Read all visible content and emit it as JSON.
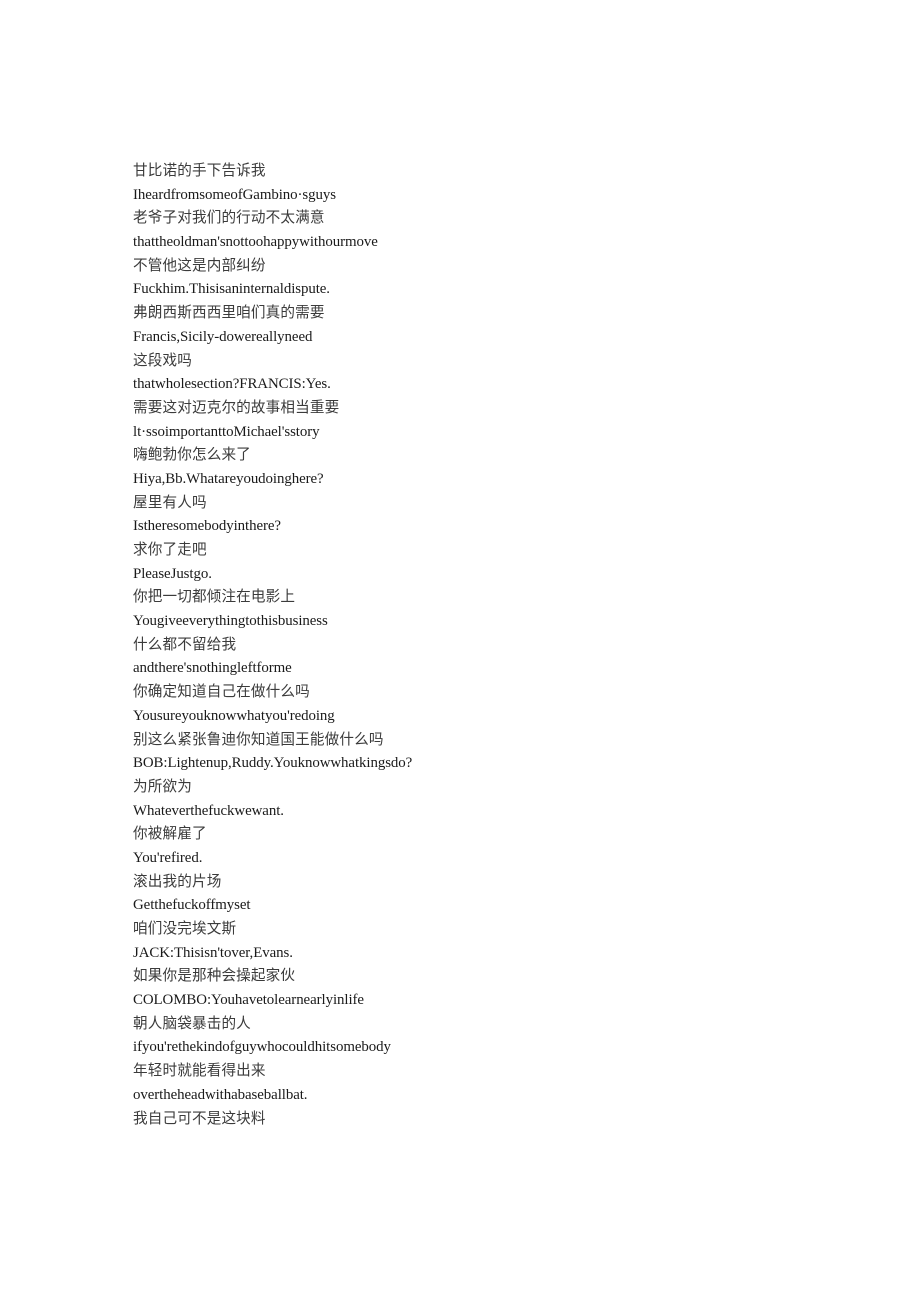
{
  "document": {
    "type": "bilingual-subtitle-transcript",
    "page_background": "#ffffff",
    "text_color_en": "#1a1a1a",
    "text_color_zh": "#3b3b3b",
    "line_count": 40
  },
  "lines": [
    {
      "lang": "zh",
      "text": "甘比诺的手下告诉我"
    },
    {
      "lang": "en",
      "text": "IheardfromsomeofGambino·sguys"
    },
    {
      "lang": "zh",
      "text": "老爷子对我们的行动不太满意"
    },
    {
      "lang": "en",
      "text": "thattheoldman'snottoohappywithourmove"
    },
    {
      "lang": "zh",
      "text": "不管他这是内部纠纷"
    },
    {
      "lang": "en",
      "text": "Fuckhim.Thisisaninternaldispute."
    },
    {
      "lang": "zh",
      "text": "弗朗西斯西西里咱们真的需要"
    },
    {
      "lang": "en",
      "text": "Francis,Sicily-dowereallyneed"
    },
    {
      "lang": "zh",
      "text": "这段戏吗"
    },
    {
      "lang": "en",
      "text": "thatwholesection?FRANCIS:Yes."
    },
    {
      "lang": "zh",
      "text": "需要这对迈克尔的故事相当重要"
    },
    {
      "lang": "en",
      "text": "lt·ssoimportanttoMichael'sstory"
    },
    {
      "lang": "zh",
      "text": "嗨鲍勃你怎么来了"
    },
    {
      "lang": "en",
      "text": "Hiya,Bb.Whatareyoudoinghere?"
    },
    {
      "lang": "zh",
      "text": "屋里有人吗"
    },
    {
      "lang": "en",
      "text": "Istheresomebodyinthere?"
    },
    {
      "lang": "zh",
      "text": "求你了走吧"
    },
    {
      "lang": "en",
      "text": "PleaseJustgo."
    },
    {
      "lang": "zh",
      "text": "你把一切都倾注在电影上"
    },
    {
      "lang": "en",
      "text": "Yougiveeverythingtothisbusiness"
    },
    {
      "lang": "zh",
      "text": "什么都不留给我"
    },
    {
      "lang": "en",
      "text": "andthere'snothingleftforme"
    },
    {
      "lang": "zh",
      "text": "你确定知道自己在做什么吗"
    },
    {
      "lang": "en",
      "text": "Yousureyouknowwhatyou'redoing"
    },
    {
      "lang": "zh",
      "text": "别这么紧张鲁迪你知道国王能做什么吗"
    },
    {
      "lang": "en",
      "text": "BOB:Lightenup,Ruddy.Youknowwhatkingsdo?"
    },
    {
      "lang": "zh",
      "text": "为所欲为"
    },
    {
      "lang": "en",
      "text": "Whateverthefuckwewant."
    },
    {
      "lang": "zh",
      "text": "你被解雇了"
    },
    {
      "lang": "en",
      "text": "You'refired."
    },
    {
      "lang": "zh",
      "text": "滚出我的片场"
    },
    {
      "lang": "en",
      "text": "Getthefuckoffmyset"
    },
    {
      "lang": "zh",
      "text": "咱们没完埃文斯"
    },
    {
      "lang": "en",
      "text": "JACK:Thisisn'tover,Evans."
    },
    {
      "lang": "zh",
      "text": "如果你是那种会操起家伙"
    },
    {
      "lang": "en",
      "text": "COLOMBO:Youhavetolearnearlyinlife"
    },
    {
      "lang": "zh",
      "text": "朝人脑袋暴击的人"
    },
    {
      "lang": "en",
      "text": "ifyou'rethekindofguywhocouldhitsomebody"
    },
    {
      "lang": "zh",
      "text": "年轻时就能看得出来"
    },
    {
      "lang": "en",
      "text": "overtheheadwithabaseballbat."
    },
    {
      "lang": "zh",
      "text": "我自己可不是这块料"
    }
  ]
}
